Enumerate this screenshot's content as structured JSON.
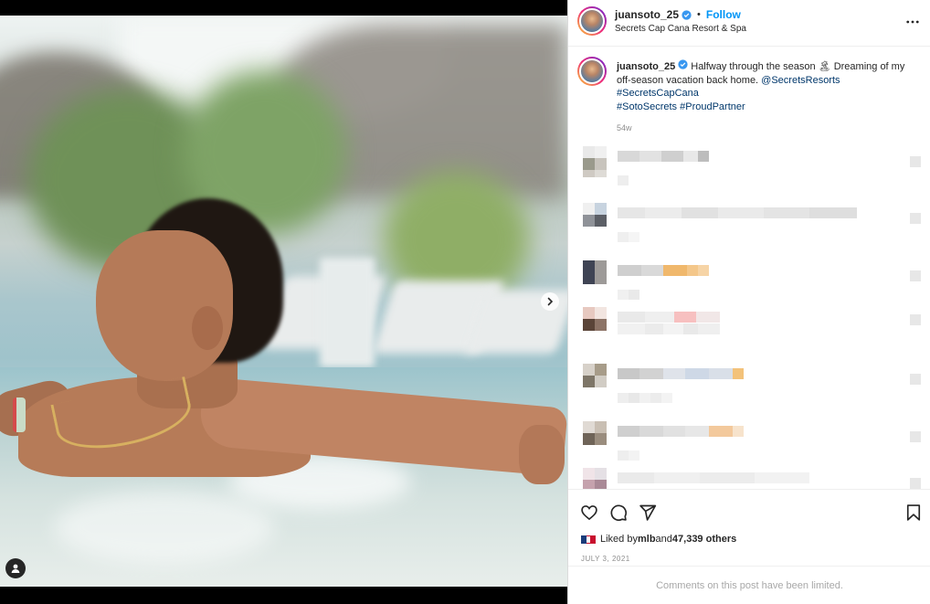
{
  "post": {
    "username": "juansoto_25",
    "follow_label": "Follow",
    "separator": "•",
    "location": "Secrets Cap Cana Resort & Spa",
    "more_icon": "more-horizontal-icon"
  },
  "caption": {
    "username": "juansoto_25",
    "text_part1": " Halfway through the season ",
    "emoji": "🏝",
    "text_part2": " Dreaming of my off-season vacation back home. ",
    "mention": "@SecretsResorts",
    "hashtag1": "#SecretsCapCana",
    "hashtag2": "#SotoSecrets",
    "hashtag3": "#ProudPartner",
    "time_ago": "54w"
  },
  "actions": {
    "like_icon": "heart-icon",
    "comment_icon": "comment-icon",
    "share_icon": "share-icon",
    "save_icon": "bookmark-icon"
  },
  "likes": {
    "prefix": "Liked by ",
    "user": "mlb",
    "middle": " and ",
    "count": "47,339 others"
  },
  "date": "JULY 3, 2021",
  "comments_limited": "Comments on this post have been limited.",
  "colors": {
    "link": "#00376b",
    "follow": "#0095f6",
    "muted": "#8e8e8e",
    "border": "#dbdbdb"
  }
}
